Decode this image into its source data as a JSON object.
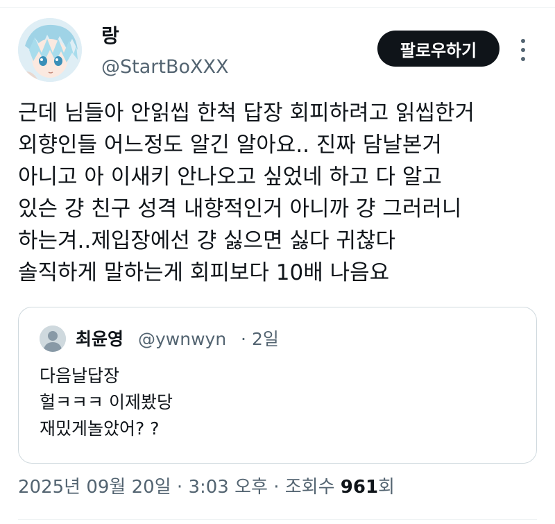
{
  "tweet": {
    "author": {
      "name": "랑",
      "handle": "@StartBoXXX"
    },
    "follow_label": "팔로우하기",
    "text_lines": [
      "근데 님들아 안읽씹 한척 답장 회피하려고 읽씹한거",
      "외향인들 어느정도 알긴 알아요.. 진짜 담날본거",
      "아니고 아 이새키 안나오고 싶었네 하고 다 알고",
      "있슨 걍 친구 성격 내향적인거 아니까 걍 그러러니",
      "하는겨..제입장에선 걍 싫으면 싫다 귀찮다",
      "솔직하게 말하는게 회피보다 10배 나음요"
    ],
    "quote": {
      "name": "최윤영",
      "handle": "@ywnwyn",
      "separator": "·",
      "time": "2일",
      "text_lines": [
        "다음날답장",
        "헐ㅋㅋㅋ 이제봤당",
        "재밌게놀았어? ?"
      ]
    },
    "meta": {
      "date": "2025년 09월 20일",
      "sep1": " · ",
      "time": "3:03 오후",
      "sep2": " · ",
      "views_label": "조회수 ",
      "views_count": "961",
      "views_suffix": "회"
    }
  },
  "colors": {
    "text_primary": "#0f1419",
    "text_secondary": "#536471",
    "border": "#cfd9de",
    "button_bg": "#0f1419"
  },
  "icons": {
    "more": "more-vertical-icon"
  }
}
